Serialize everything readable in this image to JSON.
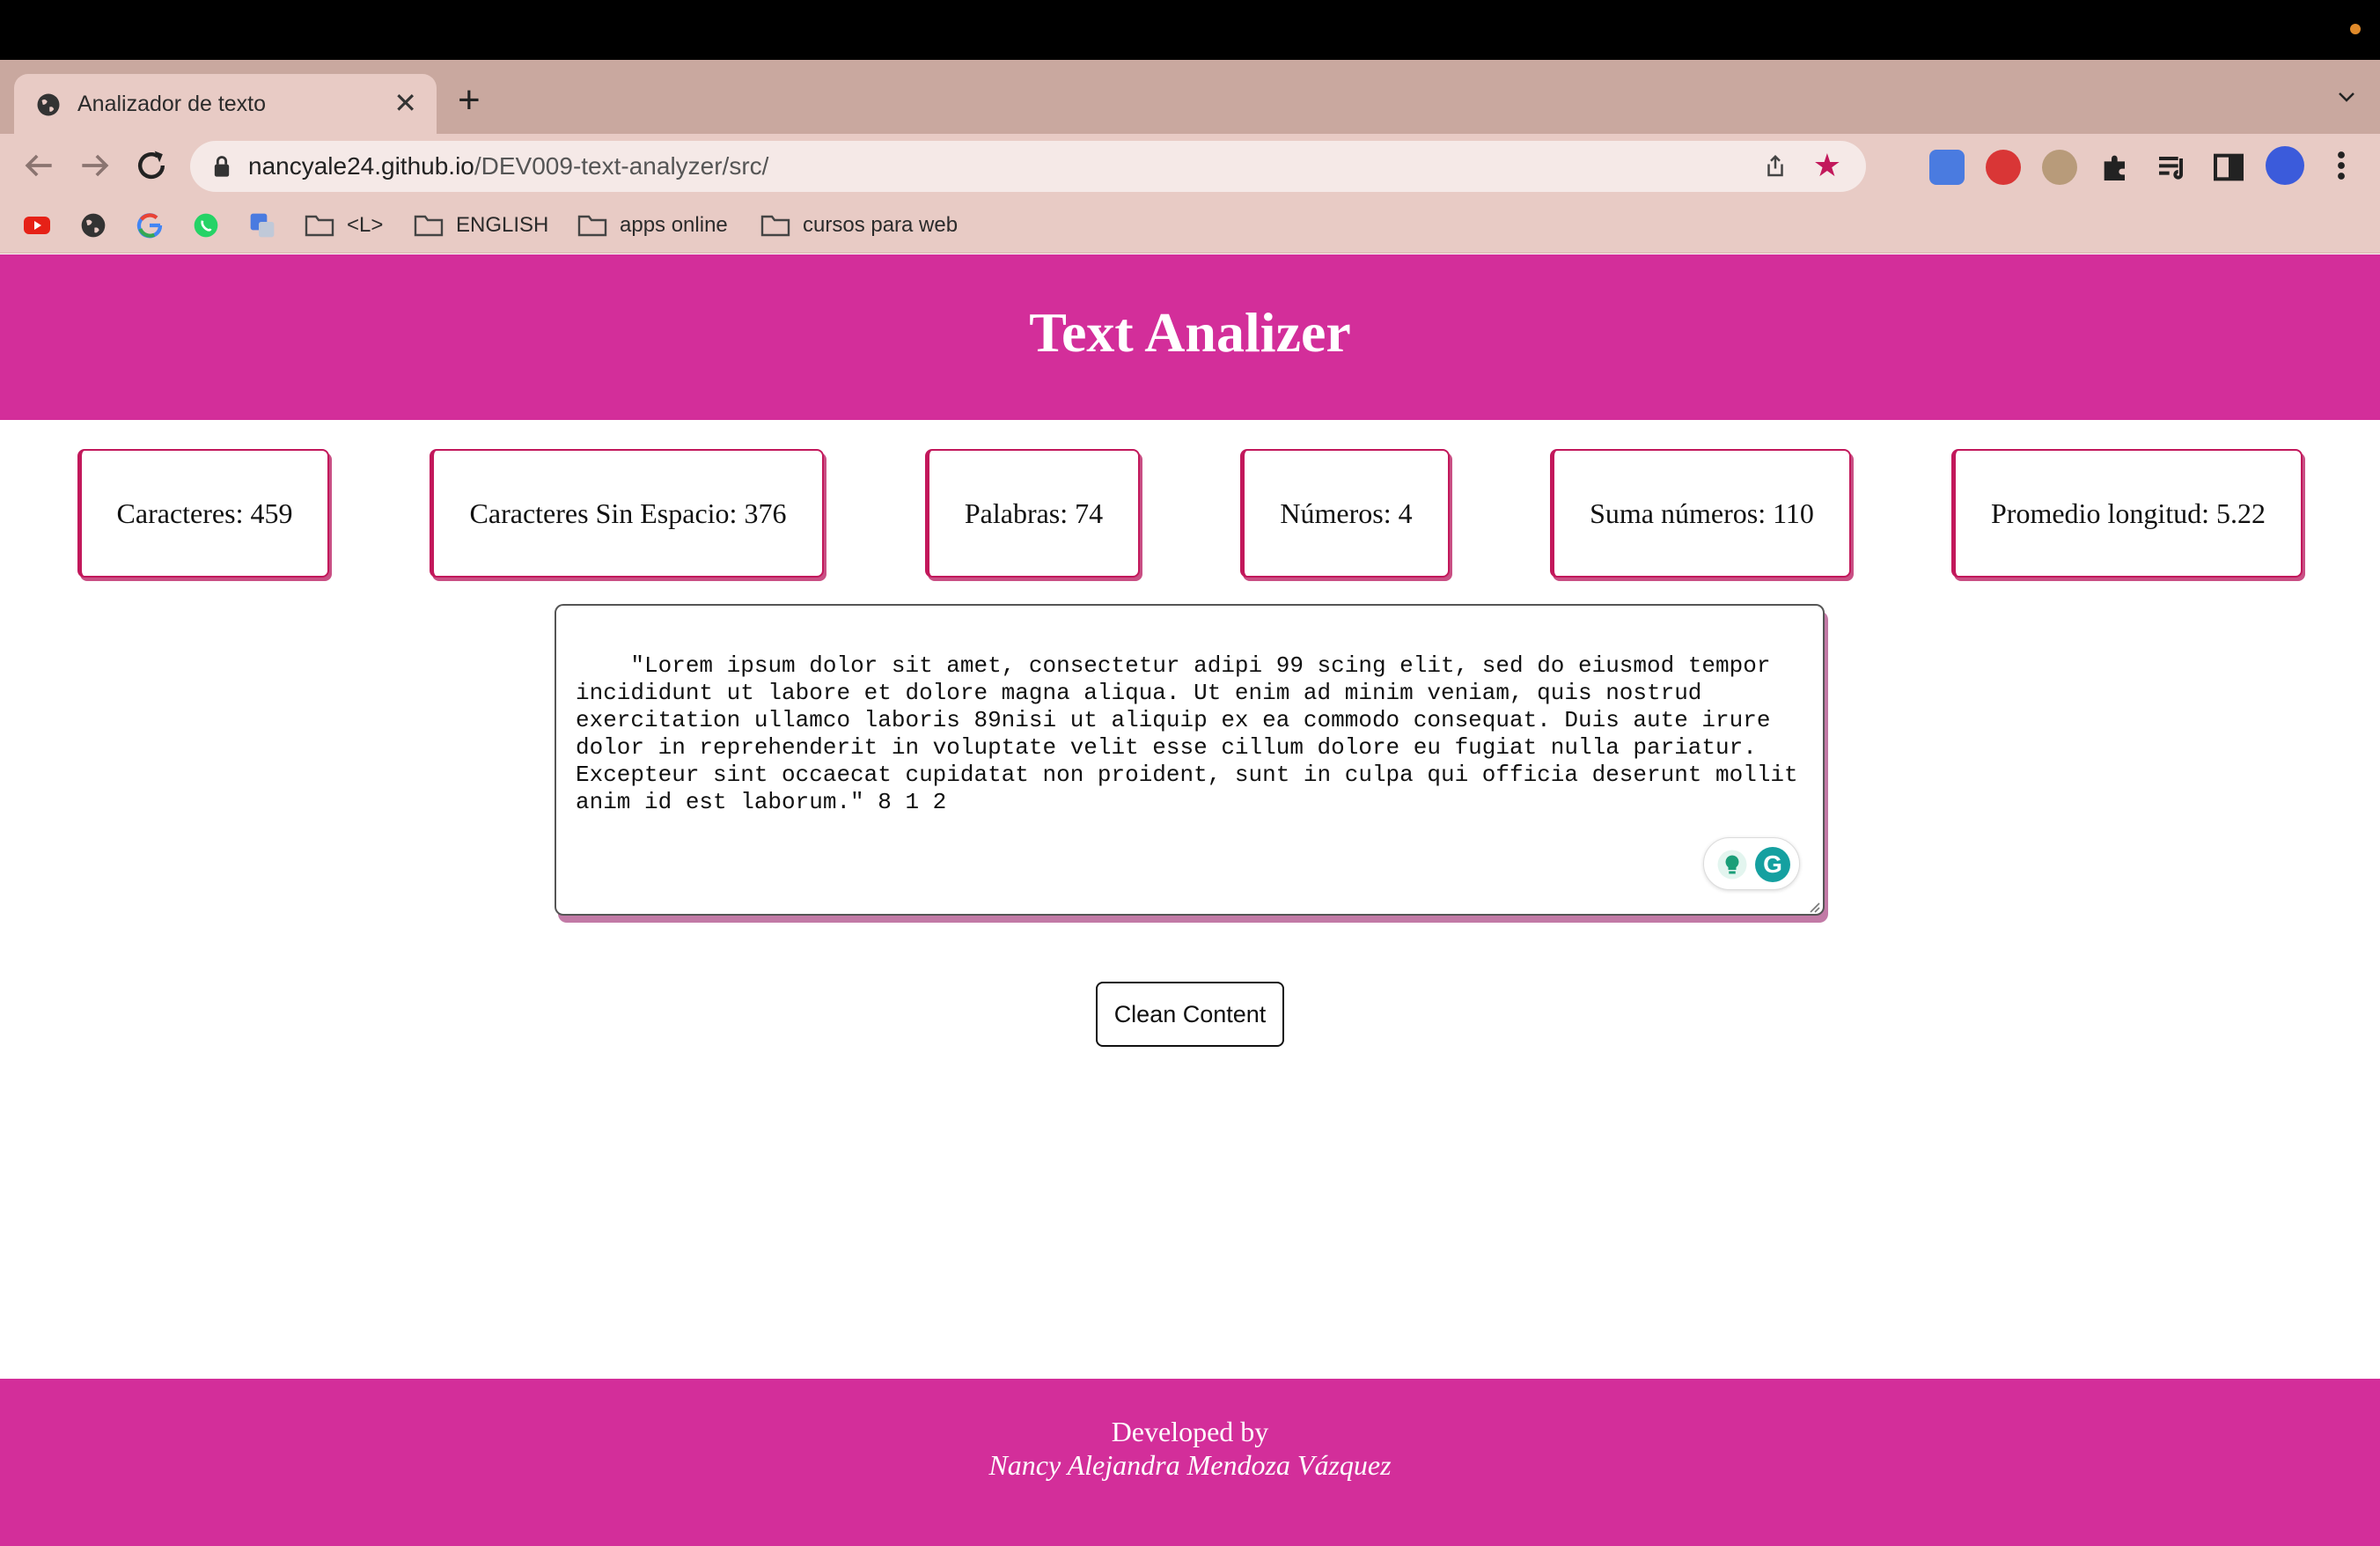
{
  "browser": {
    "tab": {
      "title": "Analizador de texto"
    },
    "url": {
      "host": "nancyale24.github.io",
      "path": "/DEV009-text-analyzer/src/"
    },
    "bookmarks": [
      {
        "type": "icon",
        "name": "youtube-icon"
      },
      {
        "type": "icon",
        "name": "globe-icon"
      },
      {
        "type": "icon",
        "name": "google-icon"
      },
      {
        "type": "icon",
        "name": "whatsapp-icon"
      },
      {
        "type": "icon",
        "name": "translate-icon"
      },
      {
        "type": "folder",
        "label": "<L>"
      },
      {
        "type": "folder",
        "label": "ENGLISH"
      },
      {
        "type": "folder",
        "label": "apps online"
      },
      {
        "type": "folder",
        "label": "cursos para web"
      }
    ],
    "extensions": [
      "google-translate-icon",
      "adblock-icon",
      "owl-extension-icon",
      "puzzle-icon",
      "reading-list-icon",
      "side-panel-icon"
    ],
    "colors": {
      "tabstrip": "#c9a89f",
      "toolbar": "#e8cbc5",
      "star": "#c2185b"
    }
  },
  "app": {
    "title": "Text Analizer",
    "metrics": [
      {
        "label": "Caracteres: 459"
      },
      {
        "label": "Caracteres Sin Espacio: 376"
      },
      {
        "label": "Palabras: 74"
      },
      {
        "label": "Números: 4"
      },
      {
        "label": "Suma números: 110"
      },
      {
        "label": "Promedio longitud: 5.22"
      }
    ],
    "textarea_value": "\"Lorem ipsum dolor sit amet, consectetur adipi 99 scing elit, sed do eiusmod tempor incididunt ut labore et dolore magna aliqua. Ut enim ad minim veniam, quis nostrud exercitation ullamco laboris 89nisi ut aliquip ex ea commodo consequat. Duis aute irure dolor in reprehenderit in voluptate velit esse cillum dolore eu fugiat nulla pariatur. Excepteur sint occaecat cupidatat non proident, sunt in culpa qui officia deserunt mollit anim id est laborum.\" 8 1 2",
    "clean_button": "Clean Content",
    "footer": {
      "line1": "Developed by",
      "line2": "Nancy Alejandra Mendoza Vázquez"
    },
    "colors": {
      "brand": "#d32e9a",
      "card_border": "#c2185b"
    }
  }
}
